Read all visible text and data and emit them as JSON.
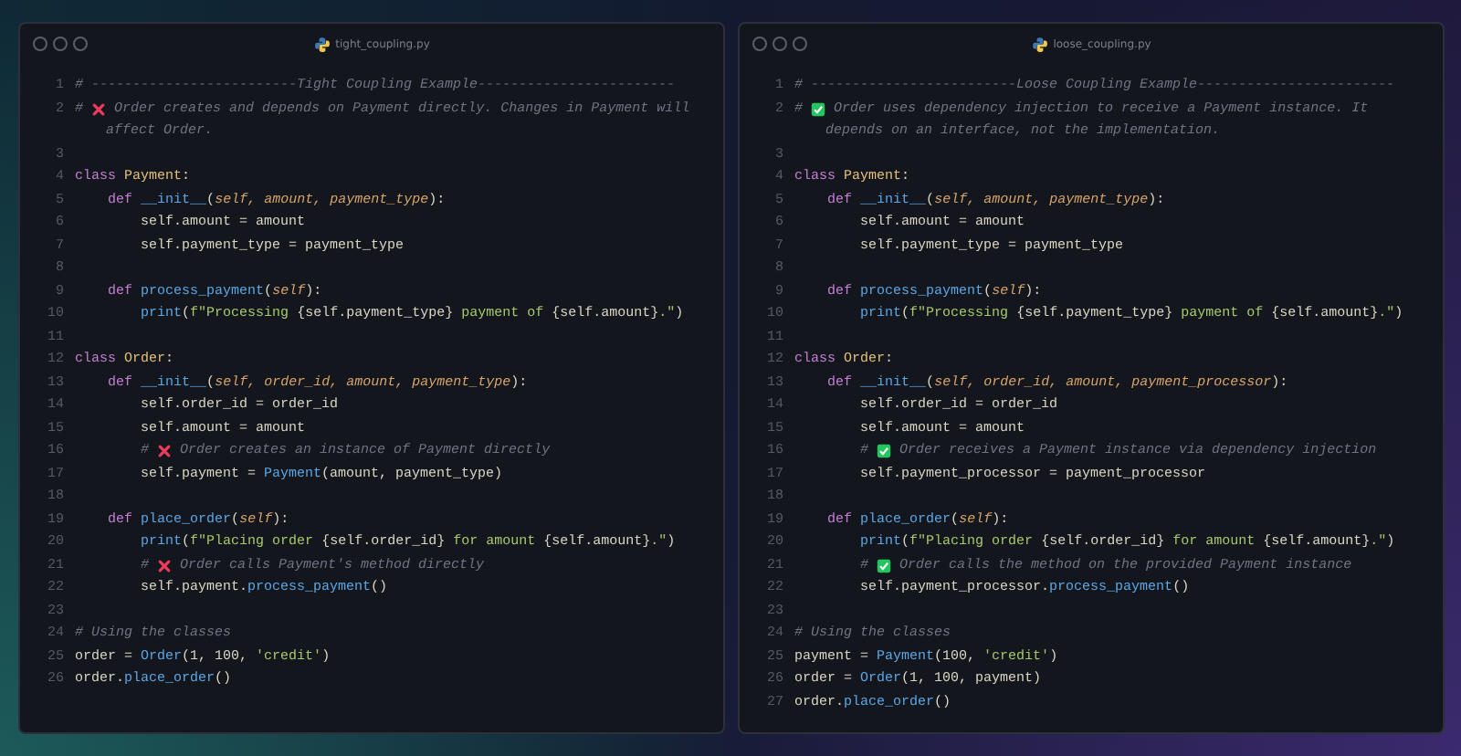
{
  "windows": [
    {
      "filename": "tight_coupling.py",
      "lines": [
        {
          "number": "1",
          "tokens": [
            {
              "kind": "comment",
              "text": "# -------------------------Tight Coupling Example------------------------"
            }
          ]
        },
        {
          "number": "2",
          "tokens": [
            {
              "kind": "comment",
              "text": "# "
            },
            {
              "kind": "cross"
            },
            {
              "kind": "comment",
              "text": " Order creates and depends on Payment directly. Changes in Payment will affect Order."
            }
          ]
        },
        {
          "number": "3"
        },
        {
          "number": "4",
          "tokens": [
            {
              "kind": "keyword",
              "text": "class "
            },
            {
              "kind": "class",
              "text": "Payment"
            },
            {
              "kind": "plain",
              "text": ":"
            }
          ]
        },
        {
          "number": "5",
          "tokens": [
            {
              "kind": "keyword",
              "text": "    def "
            },
            {
              "kind": "function",
              "text": "__init__"
            },
            {
              "kind": "plain",
              "text": "("
            },
            {
              "kind": "param",
              "text": "self, amount, payment_type"
            },
            {
              "kind": "plain",
              "text": "):"
            }
          ]
        },
        {
          "number": "6",
          "tokens": [
            {
              "kind": "plain",
              "text": "        self.amount = amount"
            }
          ]
        },
        {
          "number": "7",
          "tokens": [
            {
              "kind": "plain",
              "text": "        self.payment_type = payment_type"
            }
          ]
        },
        {
          "number": "8"
        },
        {
          "number": "9",
          "tokens": [
            {
              "kind": "keyword",
              "text": "    def "
            },
            {
              "kind": "function",
              "text": "process_payment"
            },
            {
              "kind": "plain",
              "text": "("
            },
            {
              "kind": "param",
              "text": "self"
            },
            {
              "kind": "plain",
              "text": "):"
            }
          ]
        },
        {
          "number": "10",
          "tokens": [
            {
              "kind": "function",
              "text": "        print"
            },
            {
              "kind": "plain",
              "text": "("
            },
            {
              "kind": "string",
              "text": "f\"Processing "
            },
            {
              "kind": "plain",
              "text": "{self.payment_type}"
            },
            {
              "kind": "string",
              "text": " payment of "
            },
            {
              "kind": "plain",
              "text": "{self.amount}"
            },
            {
              "kind": "string",
              "text": ".\""
            },
            {
              "kind": "plain",
              "text": ")"
            }
          ]
        },
        {
          "number": "11"
        },
        {
          "number": "12",
          "tokens": [
            {
              "kind": "keyword",
              "text": "class "
            },
            {
              "kind": "class",
              "text": "Order"
            },
            {
              "kind": "plain",
              "text": ":"
            }
          ]
        },
        {
          "number": "13",
          "tokens": [
            {
              "kind": "keyword",
              "text": "    def "
            },
            {
              "kind": "function",
              "text": "__init__"
            },
            {
              "kind": "plain",
              "text": "("
            },
            {
              "kind": "param",
              "text": "self, order_id, amount, payment_type"
            },
            {
              "kind": "plain",
              "text": "):"
            }
          ]
        },
        {
          "number": "14",
          "tokens": [
            {
              "kind": "plain",
              "text": "        self.order_id = order_id"
            }
          ]
        },
        {
          "number": "15",
          "tokens": [
            {
              "kind": "plain",
              "text": "        self.amount = amount"
            }
          ]
        },
        {
          "number": "16",
          "tokens": [
            {
              "kind": "comment",
              "text": "        # "
            },
            {
              "kind": "cross"
            },
            {
              "kind": "comment",
              "text": " Order creates an instance of Payment directly"
            }
          ]
        },
        {
          "number": "17",
          "tokens": [
            {
              "kind": "plain",
              "text": "        self.payment = "
            },
            {
              "kind": "function",
              "text": "Payment"
            },
            {
              "kind": "plain",
              "text": "(amount, payment_type)"
            }
          ]
        },
        {
          "number": "18"
        },
        {
          "number": "19",
          "tokens": [
            {
              "kind": "keyword",
              "text": "    def "
            },
            {
              "kind": "function",
              "text": "place_order"
            },
            {
              "kind": "plain",
              "text": "("
            },
            {
              "kind": "param",
              "text": "self"
            },
            {
              "kind": "plain",
              "text": "):"
            }
          ]
        },
        {
          "number": "20",
          "tokens": [
            {
              "kind": "function",
              "text": "        print"
            },
            {
              "kind": "plain",
              "text": "("
            },
            {
              "kind": "string",
              "text": "f\"Placing order "
            },
            {
              "kind": "plain",
              "text": "{self.order_id}"
            },
            {
              "kind": "string",
              "text": " for amount "
            },
            {
              "kind": "plain",
              "text": "{self.amount}"
            },
            {
              "kind": "string",
              "text": ".\""
            },
            {
              "kind": "plain",
              "text": ")"
            }
          ]
        },
        {
          "number": "21",
          "tokens": [
            {
              "kind": "comment",
              "text": "        # "
            },
            {
              "kind": "cross"
            },
            {
              "kind": "comment",
              "text": " Order calls Payment's method directly"
            }
          ]
        },
        {
          "number": "22",
          "tokens": [
            {
              "kind": "plain",
              "text": "        self.payment."
            },
            {
              "kind": "function",
              "text": "process_payment"
            },
            {
              "kind": "plain",
              "text": "()"
            }
          ]
        },
        {
          "number": "23"
        },
        {
          "number": "24",
          "tokens": [
            {
              "kind": "comment",
              "text": "# Using the classes"
            }
          ]
        },
        {
          "number": "25",
          "tokens": [
            {
              "kind": "plain",
              "text": "order = "
            },
            {
              "kind": "function",
              "text": "Order"
            },
            {
              "kind": "plain",
              "text": "(1, 100, "
            },
            {
              "kind": "string",
              "text": "'credit'"
            },
            {
              "kind": "plain",
              "text": ")"
            }
          ]
        },
        {
          "number": "26",
          "tokens": [
            {
              "kind": "plain",
              "text": "order."
            },
            {
              "kind": "function",
              "text": "place_order"
            },
            {
              "kind": "plain",
              "text": "()"
            }
          ]
        }
      ]
    },
    {
      "filename": "loose_coupling.py",
      "lines": [
        {
          "number": "1",
          "tokens": [
            {
              "kind": "comment",
              "text": "# -------------------------Loose Coupling Example------------------------"
            }
          ]
        },
        {
          "number": "2",
          "tokens": [
            {
              "kind": "comment",
              "text": "# "
            },
            {
              "kind": "check"
            },
            {
              "kind": "comment",
              "text": " Order uses dependency injection to receive a Payment instance. It depends on an interface, not the implementation."
            }
          ]
        },
        {
          "number": "3"
        },
        {
          "number": "4",
          "tokens": [
            {
              "kind": "keyword",
              "text": "class "
            },
            {
              "kind": "class",
              "text": "Payment"
            },
            {
              "kind": "plain",
              "text": ":"
            }
          ]
        },
        {
          "number": "5",
          "tokens": [
            {
              "kind": "keyword",
              "text": "    def "
            },
            {
              "kind": "function",
              "text": "__init__"
            },
            {
              "kind": "plain",
              "text": "("
            },
            {
              "kind": "param",
              "text": "self, amount, payment_type"
            },
            {
              "kind": "plain",
              "text": "):"
            }
          ]
        },
        {
          "number": "6",
          "tokens": [
            {
              "kind": "plain",
              "text": "        self.amount = amount"
            }
          ]
        },
        {
          "number": "7",
          "tokens": [
            {
              "kind": "plain",
              "text": "        self.payment_type = payment_type"
            }
          ]
        },
        {
          "number": "8"
        },
        {
          "number": "9",
          "tokens": [
            {
              "kind": "keyword",
              "text": "    def "
            },
            {
              "kind": "function",
              "text": "process_payment"
            },
            {
              "kind": "plain",
              "text": "("
            },
            {
              "kind": "param",
              "text": "self"
            },
            {
              "kind": "plain",
              "text": "):"
            }
          ]
        },
        {
          "number": "10",
          "tokens": [
            {
              "kind": "function",
              "text": "        print"
            },
            {
              "kind": "plain",
              "text": "("
            },
            {
              "kind": "string",
              "text": "f\"Processing "
            },
            {
              "kind": "plain",
              "text": "{self.payment_type}"
            },
            {
              "kind": "string",
              "text": " payment of "
            },
            {
              "kind": "plain",
              "text": "{self.amount}"
            },
            {
              "kind": "string",
              "text": ".\""
            },
            {
              "kind": "plain",
              "text": ")"
            }
          ]
        },
        {
          "number": "11"
        },
        {
          "number": "12",
          "tokens": [
            {
              "kind": "keyword",
              "text": "class "
            },
            {
              "kind": "class",
              "text": "Order"
            },
            {
              "kind": "plain",
              "text": ":"
            }
          ]
        },
        {
          "number": "13",
          "tokens": [
            {
              "kind": "keyword",
              "text": "    def "
            },
            {
              "kind": "function",
              "text": "__init__"
            },
            {
              "kind": "plain",
              "text": "("
            },
            {
              "kind": "param",
              "text": "self, order_id, amount, payment_processor"
            },
            {
              "kind": "plain",
              "text": "):"
            }
          ]
        },
        {
          "number": "14",
          "tokens": [
            {
              "kind": "plain",
              "text": "        self.order_id = order_id"
            }
          ]
        },
        {
          "number": "15",
          "tokens": [
            {
              "kind": "plain",
              "text": "        self.amount = amount"
            }
          ]
        },
        {
          "number": "16",
          "tokens": [
            {
              "kind": "comment",
              "text": "        # "
            },
            {
              "kind": "check"
            },
            {
              "kind": "comment",
              "text": " Order receives a Payment instance via dependency injection"
            }
          ]
        },
        {
          "number": "17",
          "tokens": [
            {
              "kind": "plain",
              "text": "        self.payment_processor = payment_processor"
            }
          ]
        },
        {
          "number": "18"
        },
        {
          "number": "19",
          "tokens": [
            {
              "kind": "keyword",
              "text": "    def "
            },
            {
              "kind": "function",
              "text": "place_order"
            },
            {
              "kind": "plain",
              "text": "("
            },
            {
              "kind": "param",
              "text": "self"
            },
            {
              "kind": "plain",
              "text": "):"
            }
          ]
        },
        {
          "number": "20",
          "tokens": [
            {
              "kind": "function",
              "text": "        print"
            },
            {
              "kind": "plain",
              "text": "("
            },
            {
              "kind": "string",
              "text": "f\"Placing order "
            },
            {
              "kind": "plain",
              "text": "{self.order_id}"
            },
            {
              "kind": "string",
              "text": " for amount "
            },
            {
              "kind": "plain",
              "text": "{self.amount}"
            },
            {
              "kind": "string",
              "text": ".\""
            },
            {
              "kind": "plain",
              "text": ")"
            }
          ]
        },
        {
          "number": "21",
          "tokens": [
            {
              "kind": "comment",
              "text": "        # "
            },
            {
              "kind": "check"
            },
            {
              "kind": "comment",
              "text": " Order calls the method on the provided Payment instance"
            }
          ]
        },
        {
          "number": "22",
          "tokens": [
            {
              "kind": "plain",
              "text": "        self.payment_processor."
            },
            {
              "kind": "function",
              "text": "process_payment"
            },
            {
              "kind": "plain",
              "text": "()"
            }
          ]
        },
        {
          "number": "23"
        },
        {
          "number": "24",
          "tokens": [
            {
              "kind": "comment",
              "text": "# Using the classes"
            }
          ]
        },
        {
          "number": "25",
          "tokens": [
            {
              "kind": "plain",
              "text": "payment = "
            },
            {
              "kind": "function",
              "text": "Payment"
            },
            {
              "kind": "plain",
              "text": "(100, "
            },
            {
              "kind": "string",
              "text": "'credit'"
            },
            {
              "kind": "plain",
              "text": ")"
            }
          ]
        },
        {
          "number": "26",
          "tokens": [
            {
              "kind": "plain",
              "text": "order = "
            },
            {
              "kind": "function",
              "text": "Order"
            },
            {
              "kind": "plain",
              "text": "(1, 100, payment)"
            }
          ]
        },
        {
          "number": "27",
          "tokens": [
            {
              "kind": "plain",
              "text": "order."
            },
            {
              "kind": "function",
              "text": "place_order"
            },
            {
              "kind": "plain",
              "text": "()"
            }
          ]
        }
      ]
    }
  ]
}
